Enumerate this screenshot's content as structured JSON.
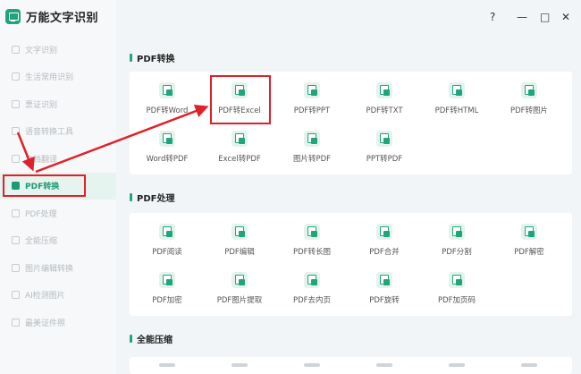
{
  "app": {
    "title": "万能文字识别"
  },
  "window": {
    "help": "?",
    "minimize": "—",
    "maximize": "□",
    "close": "✕"
  },
  "sidebar": {
    "items": [
      {
        "label": "文字识别"
      },
      {
        "label": "生活常用识别"
      },
      {
        "label": "票证识别"
      },
      {
        "label": "语音转换工具"
      },
      {
        "label": "文档翻译"
      },
      {
        "label": "PDF转换",
        "active": true
      },
      {
        "label": "PDF处理"
      },
      {
        "label": "全能压缩"
      },
      {
        "label": "图片编辑转换"
      },
      {
        "label": "AI检测图片"
      },
      {
        "label": "最美证件照"
      }
    ]
  },
  "sections": {
    "convert": {
      "title": "PDF转换",
      "tools": [
        "PDF转Word",
        "PDF转Excel",
        "PDF转PPT",
        "PDF转TXT",
        "PDF转HTML",
        "PDF转图片",
        "Word转PDF",
        "Excel转PDF",
        "图片转PDF",
        "PPT转PDF"
      ]
    },
    "process": {
      "title": "PDF处理",
      "tools": [
        "PDF阅读",
        "PDF编辑",
        "PDF转长图",
        "PDF合并",
        "PDF分割",
        "PDF解密",
        "PDF加密",
        "PDF图片提取",
        "PDF去内页",
        "PDF旋转",
        "PDF加页码"
      ]
    },
    "compress": {
      "title": "全能压缩"
    }
  },
  "colors": {
    "accent": "#1fa47e",
    "highlight": "#e0202a"
  }
}
